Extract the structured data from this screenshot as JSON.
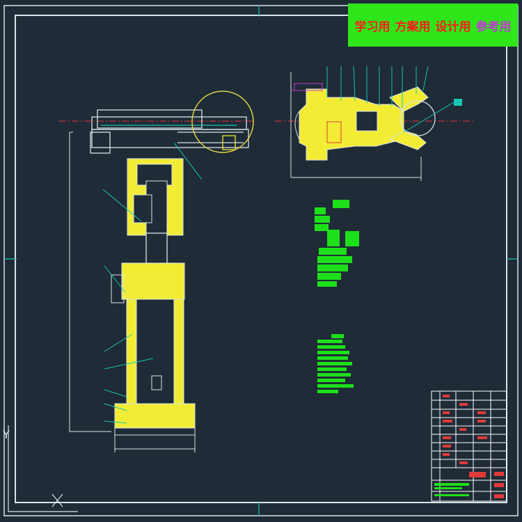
{
  "banner": {
    "labels": [
      "学习用",
      "方案用",
      "设计用",
      "参考用"
    ],
    "colors": {
      "background": "#2ee61a",
      "text": "#ff1a1a",
      "text_alt": "#c23ad6"
    }
  },
  "ucs": {
    "x_label": "X",
    "y_label": "Y"
  },
  "colors": {
    "background": "#1f2b36",
    "frame": "#d9e4ea",
    "dimension": "#17c7b4",
    "hatch": "#f2ec35",
    "centerline": "#e03a3a",
    "table_text": "#1ee01a",
    "title_block": "#ffffff",
    "highlight": "#e0d24a"
  },
  "drawing": {
    "views": [
      "front-view-robot-arm",
      "top-view-gripper"
    ],
    "tables": [
      "parts-notes",
      "technical-requirements",
      "title-block"
    ]
  }
}
